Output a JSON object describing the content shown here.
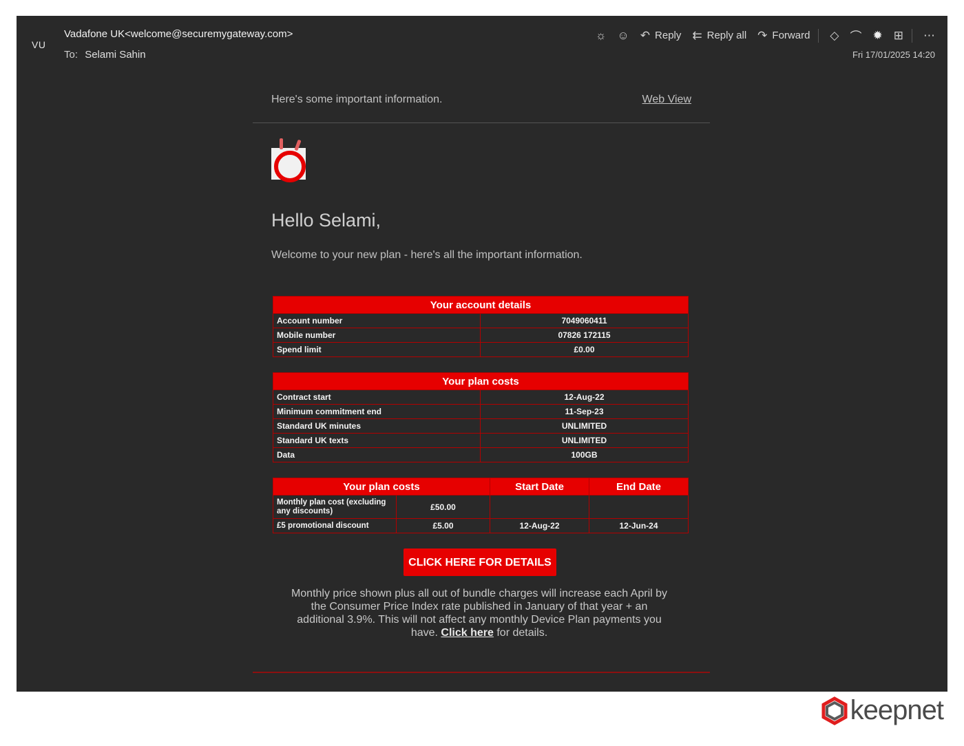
{
  "email": {
    "avatar_initials": "VU",
    "from": "Vadafone UK<welcome@securemygateway.com>",
    "to_label": "To:",
    "to": "Selami Sahin",
    "datetime": "Fri 17/01/2025 14:20",
    "actions": {
      "reply": "Reply",
      "reply_all": "Reply all",
      "forward": "Forward"
    }
  },
  "message": {
    "preheader": "Here's some important information.",
    "web_view": "Web View",
    "greeting": "Hello Selami,",
    "intro": "Welcome to your new plan - here's all the important information.",
    "account_table": {
      "title": "Your account details",
      "rows": [
        {
          "label": "Account number",
          "value": "7049060411"
        },
        {
          "label": "Mobile number",
          "value": "07826 172115"
        },
        {
          "label": "Spend limit",
          "value": "£0.00"
        }
      ]
    },
    "plan_table": {
      "title": "Your plan costs",
      "rows": [
        {
          "label": "Contract start",
          "value": "12-Aug-22"
        },
        {
          "label": "Minimum commitment end",
          "value": "11-Sep-23"
        },
        {
          "label": "Standard UK minutes",
          "value": "UNLIMITED"
        },
        {
          "label": "Standard UK texts",
          "value": "UNLIMITED"
        },
        {
          "label": "Data",
          "value": "100GB"
        }
      ]
    },
    "cost_table": {
      "headers": [
        "Your plan costs",
        "Start Date",
        "End Date"
      ],
      "rows": [
        {
          "label": "Monthly plan cost (excluding any discounts)",
          "amount": "£50.00",
          "start": "",
          "end": ""
        },
        {
          "label": "£5 promotional discount",
          "amount": "£5.00",
          "start": "12-Aug-22",
          "end": "12-Jun-24"
        }
      ]
    },
    "cta": "CLICK HERE FOR DETAILS",
    "footer_text": "Monthly price shown plus all out of bundle charges will increase each April by the Consumer Price Index rate published in January of that year + an additional 3.9%. This will not affect any monthly Device Plan payments you have.",
    "footer_link": "Click here",
    "footer_suffix": "for details."
  },
  "watermark": {
    "brand": "keepnet"
  },
  "colors": {
    "accent_red": "#e60000",
    "background": "#292929"
  }
}
